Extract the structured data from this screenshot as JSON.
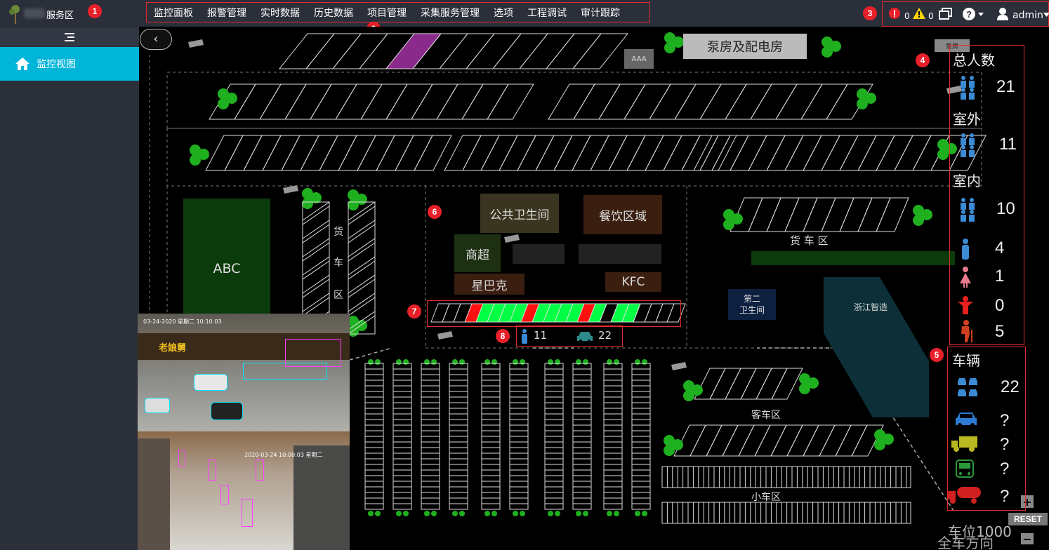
{
  "brand": {
    "name": "服务区"
  },
  "badges": [
    "1",
    "2",
    "3",
    "4",
    "5",
    "6",
    "7",
    "8"
  ],
  "nav": [
    "监控面板",
    "报警管理",
    "实时数据",
    "历史数据",
    "项目管理",
    "采集服务管理",
    "选项",
    "工程调试",
    "审计跟踪"
  ],
  "status": {
    "alarm_count": "0",
    "warning_count": "0",
    "user": "admin",
    "help": "?"
  },
  "sidebar": {
    "items": [
      {
        "label": "监控视图",
        "icon": "home-icon"
      }
    ]
  },
  "map": {
    "labels": {
      "power_room": "泵房及配电房",
      "aaa": "AAA",
      "abc": "ABC",
      "truck_zone_v": [
        "货",
        "车",
        "区"
      ],
      "truck_zone_h": "货    车    区",
      "toilet": "公共卫生间",
      "dining": "餐饮区域",
      "market": "商超",
      "starbucks": "星巴克",
      "kfc": "KFC",
      "toilet2_line1": "第二",
      "toilet2_line2": "卫生间",
      "zjzz": "浙江智造",
      "bus_zone": "客车区",
      "car_zone": "小车区",
      "bottom_a": "车位1000",
      "bottom_b": "全车方向",
      "reset": "RESET",
      "plus": "+",
      "minus": "−",
      "small_tag": "泵房"
    },
    "occupancy": {
      "people": "11",
      "cars": "22"
    }
  },
  "stats": {
    "total_label": "总人数",
    "total": "21",
    "outdoor_label": "室外",
    "outdoor": "11",
    "indoor_label": "室内",
    "indoor": "10",
    "male": "4",
    "female": "1",
    "child": "0",
    "elder": "5"
  },
  "vehicles": {
    "label": "车辆",
    "total": "22",
    "car": "?",
    "truck": "?",
    "bus": "?",
    "tanker": "?"
  },
  "video": {
    "ts1": "03-24-2020 星期二 10:10:03",
    "ts2": "2020-03-24 10:00:03 星期二",
    "sign": "老娘舅"
  },
  "colors": {
    "accent": "#00b5d8",
    "badge": "#e8202a",
    "highlight": "#00ff44",
    "alarm": "#ff1010"
  }
}
